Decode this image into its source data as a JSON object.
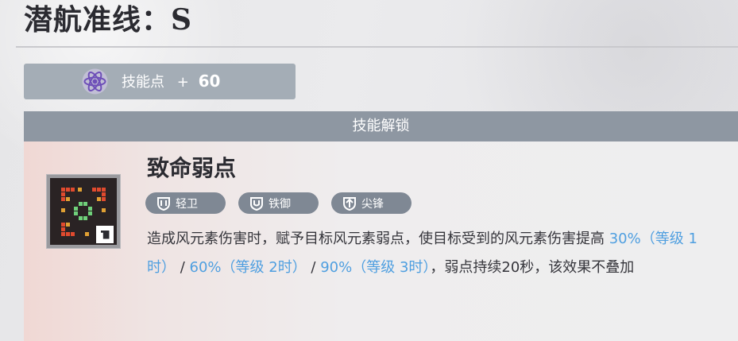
{
  "title": "潜航准线：S",
  "skill_points": {
    "icon": "atom-icon",
    "label": "技能点",
    "plus": "+",
    "value": "60"
  },
  "unlock": {
    "header": "技能解锁",
    "skill": {
      "icon": "weak-point-skill-icon",
      "name": "致命弱点",
      "tags": [
        {
          "icon": "light-guard-icon",
          "label": "轻卫"
        },
        {
          "icon": "iron-defense-icon",
          "label": "铁御"
        },
        {
          "icon": "spearhead-icon",
          "label": "尖锋"
        }
      ],
      "description": {
        "p1": "造成风元素伤害时，赋予目标风元素弱点，使目标受到的风元素伤害提高 ",
        "v1": "30%（等级 1时）",
        "sep1": " / ",
        "v2": "60%（等级 2时）",
        "sep2": " / ",
        "v3": "90%（等级 3时）",
        "p2": "，弱点持续20秒，该效果不叠加"
      }
    }
  },
  "colors": {
    "highlight": "#4f9fe0",
    "header_bg": "#8e97a2",
    "pill_bg": "#a4adb6",
    "tag_bg": "#7f8894",
    "icon_red": "#e04a2e",
    "icon_gold": "#e0a033",
    "icon_green": "#6fd07a"
  }
}
